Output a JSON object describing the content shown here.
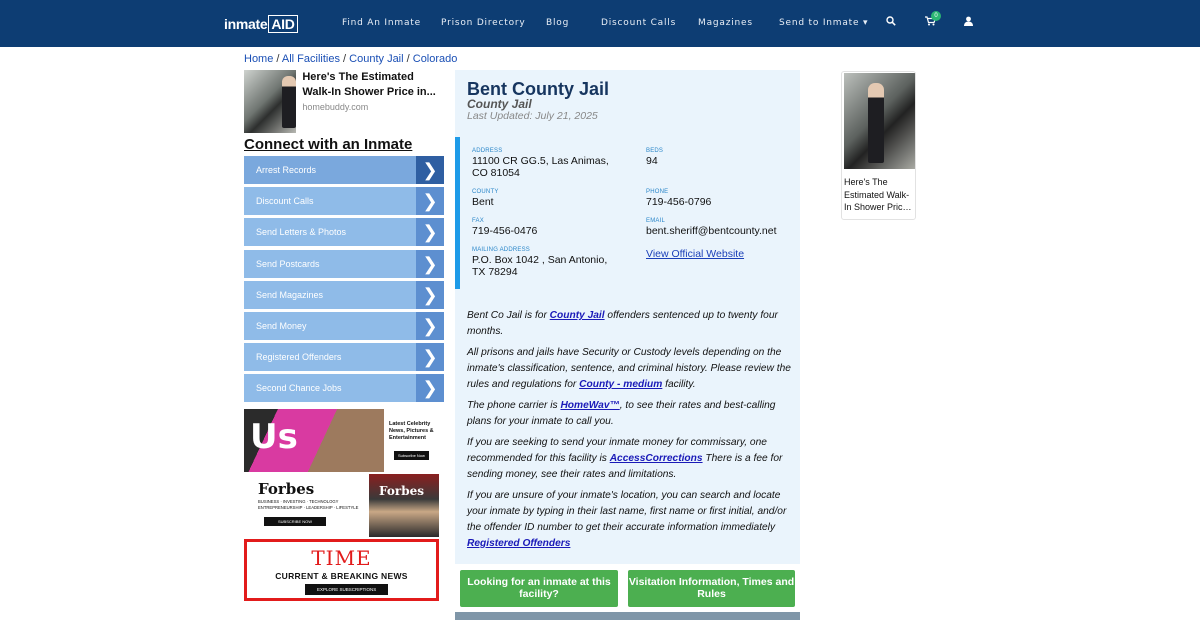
{
  "nav": {
    "logo_main": "inmate",
    "logo_box": "AID",
    "items": [
      "Find An Inmate",
      "Prison Directory",
      "Blog",
      "Discount Calls",
      "Magazines",
      "Send to Inmate ▾"
    ],
    "cart_count": "0"
  },
  "breadcrumb": [
    "Home",
    "All Facilities",
    "County Jail",
    "Colorado"
  ],
  "ad_top": {
    "headline": "Here's The Estimated Walk-In Shower Price in...",
    "source": "homebuddy.com"
  },
  "connect": {
    "title": "Connect with an Inmate",
    "items": [
      "Arrest Records",
      "Discount Calls",
      "Send Letters & Photos",
      "Send Postcards",
      "Send Magazines",
      "Send Money",
      "Registered Offenders",
      "Second Chance Jobs"
    ]
  },
  "banners": {
    "us": {
      "logo": "Us",
      "text": "Latest Celebrity News, Pictures & Entertainment",
      "button": "Subscribe Now"
    },
    "forbes": {
      "logo": "Forbes",
      "text": "BUSINESS · INVESTING · TECHNOLOGY ENTREPRENEURSHIP · LEADERSHIP · LIFESTYLE",
      "button": "SUBSCRIBE NOW",
      "cover": "Forbes"
    },
    "time": {
      "logo": "TIME",
      "text": "CURRENT & BREAKING NEWS",
      "button": "EXPLORE SUBSCRIPTIONS"
    }
  },
  "facility": {
    "name": "Bent County Jail",
    "type": "County Jail",
    "updated": "Last Updated: July 21, 2025",
    "address_label": "ADDRESS",
    "address": "11100 CR GG.5, Las Animas, CO 81054",
    "beds_label": "BEDS",
    "beds": "94",
    "county_label": "COUNTY",
    "county": "Bent",
    "phone_label": "PHONE",
    "phone": "719-456-0796",
    "fax_label": "FAX",
    "fax": "719-456-0476",
    "email_label": "EMAIL",
    "email": "bent.sheriff@bentcounty.net",
    "mailing_label": "MAILING ADDRESS",
    "mailing": "P.O. Box 1042 , San Antonio, TX 78294",
    "website_link": "View Official Website"
  },
  "description": {
    "p1_a": "Bent Co Jail is for ",
    "p1_link": "County Jail",
    "p1_b": " offenders sentenced up to twenty four months.",
    "p2_a": "All prisons and jails have Security or Custody levels depending on the inmate's classification, sentence, and criminal history. Please review the rules and regulations for ",
    "p2_link": "County - medium",
    "p2_b": " facility.",
    "p3_a": "The phone carrier is ",
    "p3_link": "HomeWav™",
    "p3_b": ", to see their rates and best-calling plans for your inmate to call you.",
    "p4_a": "If you are seeking to send your inmate money for commissary, one recommended for this facility is ",
    "p4_link": "AccessCorrections",
    "p4_b": " There is a fee for sending money, see their rates and limitations.",
    "p5_a": "If you are unsure of your inmate's location, you can search and locate your inmate by typing in their last name, first name or first initial, and/or the offender ID number to get their accurate information immediately ",
    "p5_link": "Registered Offenders"
  },
  "buttons": {
    "looking": "Looking for an inmate at this facility?",
    "visitation": "Visitation Information, Times and Rules"
  },
  "ad_right": {
    "headline": "Here's The Estimated Walk-In Shower Pric…"
  }
}
